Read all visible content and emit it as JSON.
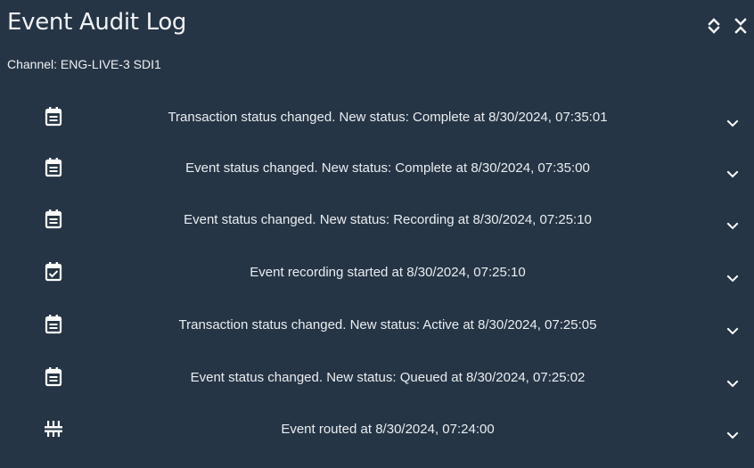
{
  "panel": {
    "title": "Event Audit Log",
    "channel_label": "Channel: ENG-LIVE-3 SDI1",
    "expand_icon": "unfold-more-icon",
    "collapse_icon": "unfold-less-icon"
  },
  "colors": {
    "background": "#263545",
    "text": "#e9edf1",
    "icon": "#ffffff"
  },
  "events": [
    {
      "icon": "calendar-notes-icon",
      "text": "Transaction status changed. New status: Complete at 8/30/2024, 07:35:01"
    },
    {
      "icon": "calendar-notes-icon",
      "text": "Event status changed. New status: Complete at 8/30/2024, 07:35:00"
    },
    {
      "icon": "calendar-notes-icon",
      "text": "Event status changed. New status: Recording at 8/30/2024, 07:25:10"
    },
    {
      "icon": "calendar-check-icon",
      "text": "Event recording started at 8/30/2024, 07:25:10"
    },
    {
      "icon": "calendar-notes-icon",
      "text": "Transaction status changed. New status: Active at 8/30/2024, 07:25:05"
    },
    {
      "icon": "calendar-notes-icon",
      "text": "Event status changed. New status: Queued at 8/30/2024, 07:25:02"
    },
    {
      "icon": "router-icon",
      "text": "Event routed at 8/30/2024, 07:24:00"
    }
  ]
}
